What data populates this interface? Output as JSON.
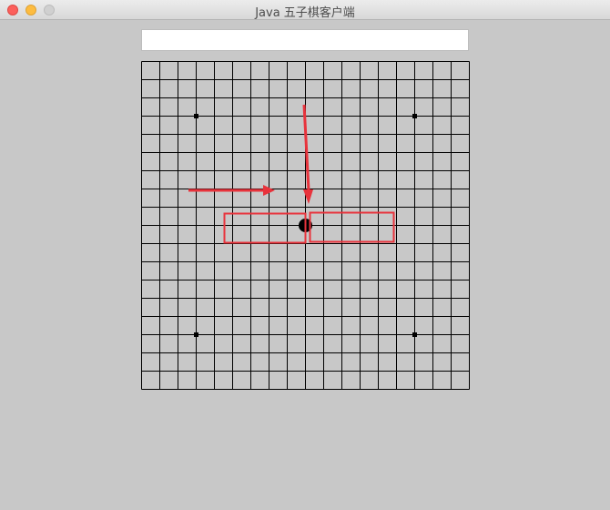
{
  "window": {
    "title": "Java 五子棋客户端",
    "controls": [
      "close",
      "minimize",
      "zoom"
    ]
  },
  "message_field": {
    "value": ""
  },
  "board": {
    "cells": 18,
    "star_points": [
      [
        3,
        3
      ],
      [
        15,
        3
      ],
      [
        3,
        15
      ],
      [
        15,
        15
      ]
    ],
    "stones": [
      {
        "color": "black",
        "col": 9,
        "row": 9
      }
    ]
  },
  "annotations": {
    "color": "#e8333c",
    "arrows": [
      "horizontal-arrow",
      "vertical-arrow"
    ],
    "boxes": [
      "left-highlight-box",
      "right-highlight-box"
    ]
  }
}
